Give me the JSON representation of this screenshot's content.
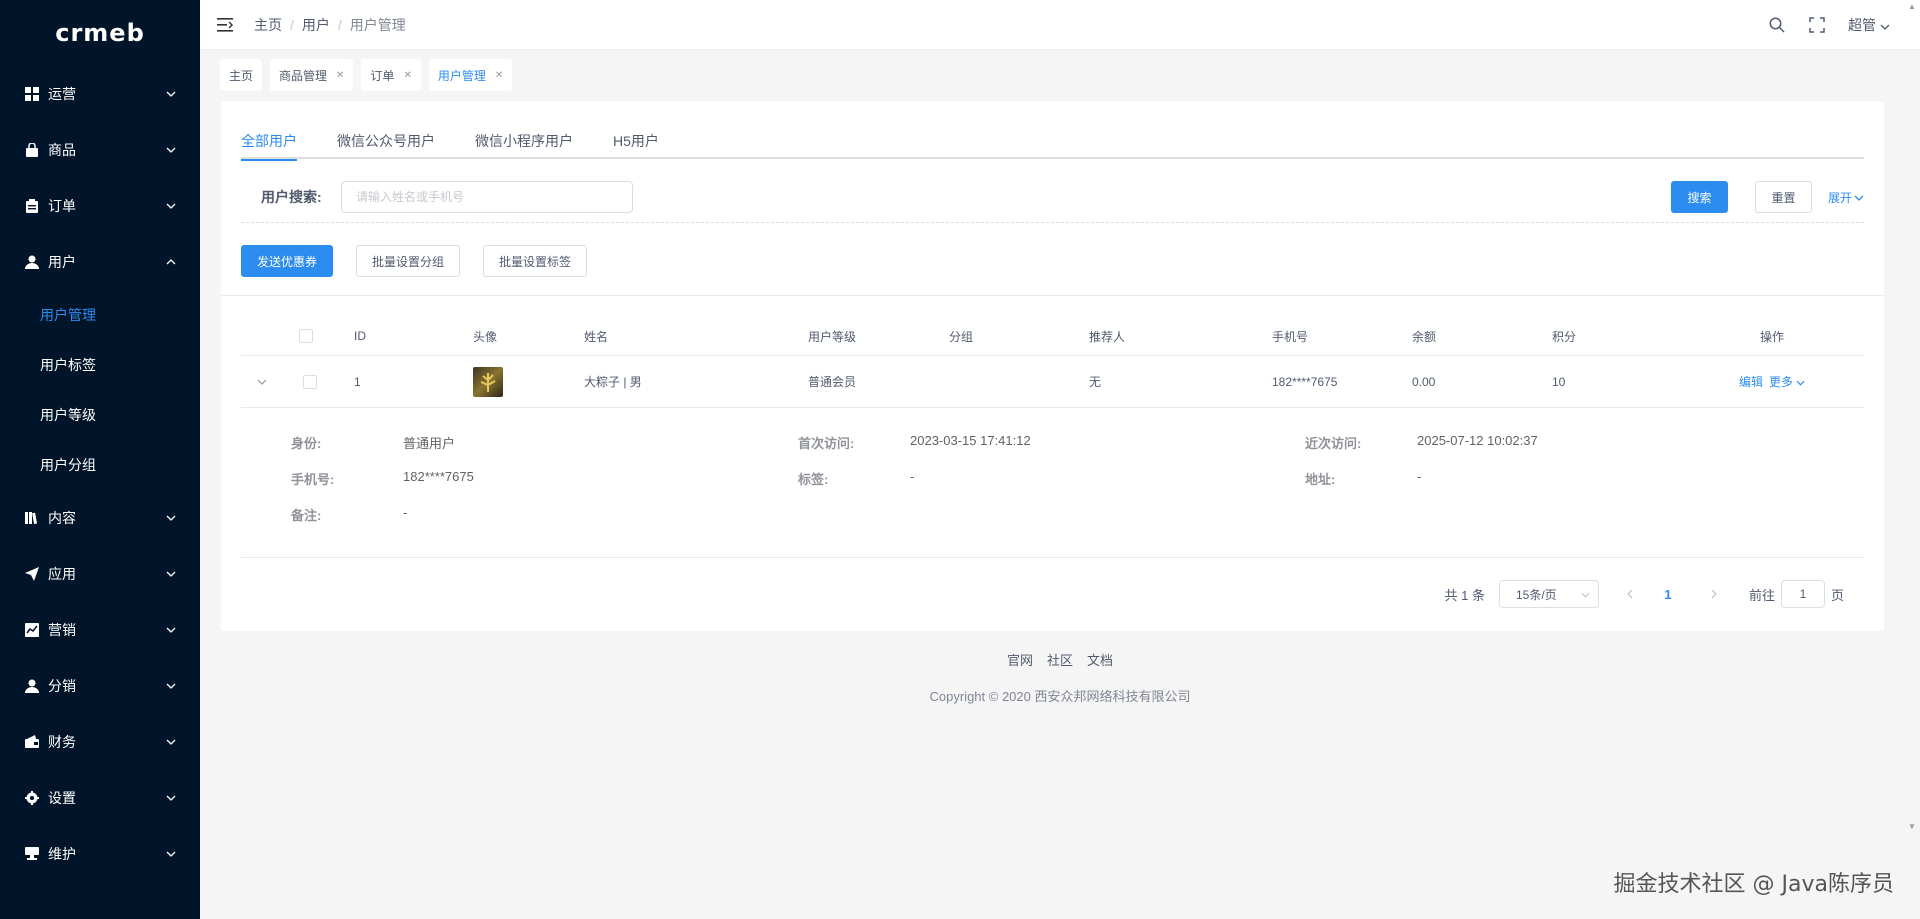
{
  "logo": "crmeb",
  "sidebar": {
    "items": [
      {
        "label": "运营",
        "icon": "dashboard-icon"
      },
      {
        "label": "商品",
        "icon": "shopping-bag-icon"
      },
      {
        "label": "订单",
        "icon": "clipboard-icon"
      },
      {
        "label": "用户",
        "icon": "user-icon"
      },
      {
        "label": "内容",
        "icon": "book-icon"
      },
      {
        "label": "应用",
        "icon": "send-icon"
      },
      {
        "label": "营销",
        "icon": "chart-icon"
      },
      {
        "label": "分销",
        "icon": "user-icon"
      },
      {
        "label": "财务",
        "icon": "wallet-icon"
      },
      {
        "label": "设置",
        "icon": "gear-icon"
      },
      {
        "label": "维护",
        "icon": "server-icon"
      }
    ],
    "user_submenu": [
      "用户管理",
      "用户标签",
      "用户等级",
      "用户分组"
    ]
  },
  "header": {
    "breadcrumb": [
      "主页",
      "用户",
      "用户管理"
    ],
    "user": "超管"
  },
  "tabs": [
    {
      "label": "主页",
      "closable": false
    },
    {
      "label": "商品管理",
      "closable": true
    },
    {
      "label": "订单",
      "closable": true
    },
    {
      "label": "用户管理",
      "closable": true
    }
  ],
  "user_tabs": [
    "全部用户",
    "微信公众号用户",
    "微信小程序用户",
    "H5用户"
  ],
  "search": {
    "label": "用户搜索:",
    "placeholder": "请输入姓名或手机号",
    "search_btn": "搜索",
    "reset_btn": "重置",
    "expand": "展开"
  },
  "actions": [
    "发送优惠券",
    "批量设置分组",
    "批量设置标签"
  ],
  "table": {
    "columns": [
      "ID",
      "头像",
      "姓名",
      "用户等级",
      "分组",
      "推荐人",
      "手机号",
      "余额",
      "积分",
      "操作"
    ],
    "rows": [
      {
        "id": "1",
        "name": "大粽子 | 男",
        "level": "普通会员",
        "group": "",
        "referrer": "无",
        "phone": "182****7675",
        "balance": "0.00",
        "points": "10",
        "edit": "编辑",
        "more": "更多"
      }
    ],
    "detail": {
      "identity_k": "身份:",
      "identity_v": "普通用户",
      "first_visit_k": "首次访问:",
      "first_visit_v": "2023-03-15 17:41:12",
      "last_visit_k": "近次访问:",
      "last_visit_v": "2025-07-12 10:02:37",
      "phone_k": "手机号:",
      "phone_v": "182****7675",
      "tag_k": "标签:",
      "tag_v": "-",
      "address_k": "地址:",
      "address_v": "-",
      "remark_k": "备注:",
      "remark_v": "-"
    }
  },
  "pagination": {
    "total": "共 1 条",
    "page_size": "15条/页",
    "current": "1",
    "goto_label": "前往",
    "goto_value": "1",
    "page_unit": "页"
  },
  "footer": {
    "links": [
      "官网",
      "社区",
      "文档"
    ],
    "copyright": "Copyright © 2020 西安众邦网络科技有限公司"
  },
  "watermark": "掘金技术社区 @ Java陈序员"
}
